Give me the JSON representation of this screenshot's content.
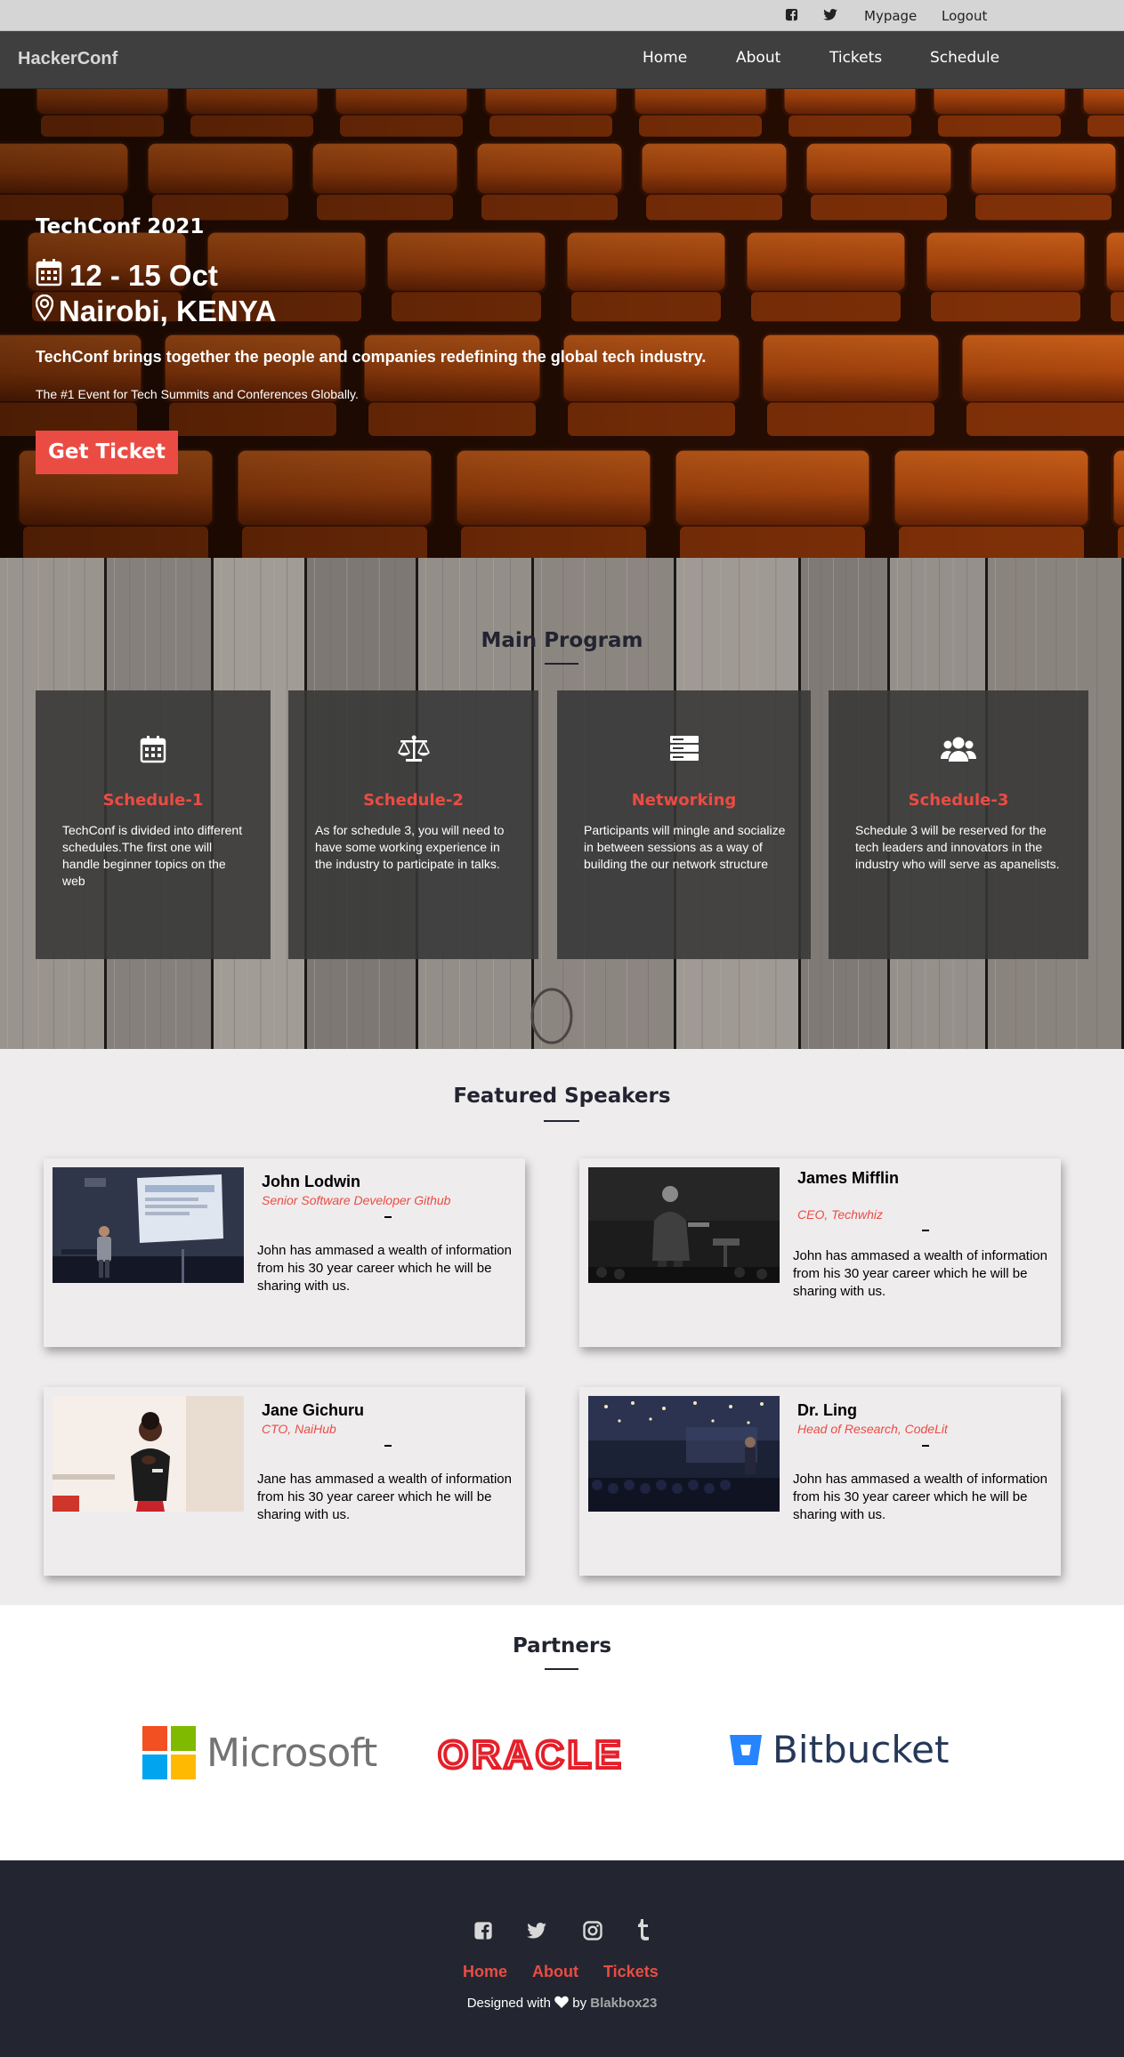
{
  "topbar": {
    "icons": [
      "facebook-icon",
      "twitter-icon"
    ],
    "mypage": "Mypage",
    "logout": "Logout"
  },
  "nav": {
    "brand": "HackerConf",
    "links": [
      "Home",
      "About",
      "Tickets",
      "Schedule"
    ]
  },
  "hero": {
    "event": "TechConf 2021",
    "date": "12 - 15 Oct",
    "location": "Nairobi, KENYA",
    "tagline": "TechConf brings together the people and companies redefining the global tech industry.",
    "sub": "The #1 Event for Tech Summits and Conferences Globally.",
    "button": "Get Ticket",
    "date_icon": "calendar-icon",
    "location_icon": "map-marker-icon"
  },
  "program": {
    "title": "Main Program",
    "cards": [
      {
        "icon": "calendar-icon",
        "title": "Schedule-1",
        "text": "TechConf is divided into different schedules.The first one will handle beginner topics on the web"
      },
      {
        "icon": "balance-scale-icon",
        "title": "Schedule-2",
        "text": "As for schedule 3, you will need to have some working experience in the industry to participate in talks."
      },
      {
        "icon": "server-icon",
        "title": "Networking",
        "text": "Participants will mingle and socialize in between sessions as a way of building the our network structure"
      },
      {
        "icon": "users-icon",
        "title": "Schedule-3",
        "text": "Schedule 3 will be reserved for the tech leaders and innovators in the industry who will serve as apanelists."
      }
    ]
  },
  "speakers": {
    "title": "Featured Speakers",
    "list": [
      {
        "name": "John Lodwin",
        "role": "Senior Software Developer Github",
        "bio": "John has ammased a wealth of information from his 30 year career which he will be sharing with us."
      },
      {
        "name": "James Mifflin",
        "role": "CEO, Techwhiz",
        "bio": "John has ammased a wealth of information from his 30 year career which he will be sharing with us."
      },
      {
        "name": "Jane Gichuru",
        "role": "CTO, NaiHub",
        "bio": "Jane has ammased a wealth of information from his 30 year career which he will be sharing with us."
      },
      {
        "name": "Dr. Ling",
        "role": "Head of Research, CodeLit",
        "bio": "John has ammased a wealth of information from his 30 year career which he will be sharing with us."
      }
    ]
  },
  "partners": {
    "title": "Partners",
    "logos": [
      "Microsoft",
      "ORACLE",
      "Bitbucket"
    ]
  },
  "footer": {
    "icons": [
      "facebook-icon",
      "twitter-icon",
      "instagram-icon",
      "tumblr-icon"
    ],
    "links": [
      "Home",
      "About",
      "Tickets"
    ],
    "credit_prefix": "Designed with",
    "credit_by": "by",
    "credit_author": "Blakbox23"
  },
  "colors": {
    "accent": "#ea4c43",
    "nav_bg": "#3f3f3f",
    "footer_bg": "#232630",
    "microsoft_red": "#f25022",
    "microsoft_green": "#7fba00",
    "microsoft_blue": "#00a4ef",
    "microsoft_yellow": "#ffb900",
    "oracle_red": "#e4202a",
    "bitbucket_blue": "#2684ff"
  }
}
